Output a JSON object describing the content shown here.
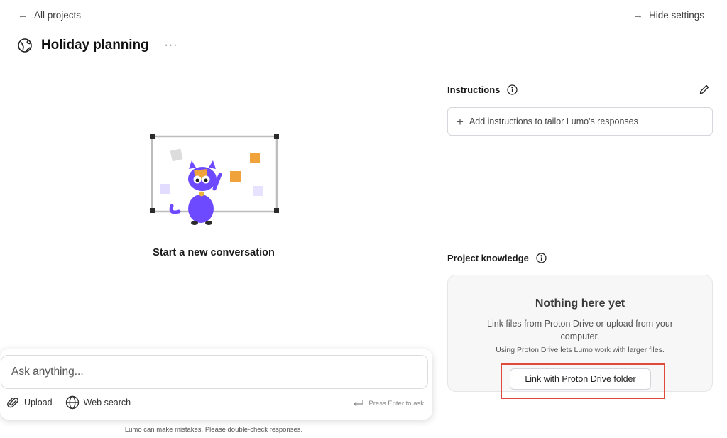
{
  "nav": {
    "back_label": "All projects",
    "hide_settings_label": "Hide settings"
  },
  "project": {
    "title": "Holiday planning",
    "more_label": "···"
  },
  "empty_chat": {
    "heading": "Start a new conversation"
  },
  "composer": {
    "placeholder": "Ask anything...",
    "upload_label": "Upload",
    "web_search_label": "Web search",
    "enter_hint": "Press Enter to ask",
    "disclaimer": "Lumo can make mistakes. Please double-check responses."
  },
  "instructions": {
    "label": "Instructions",
    "add_label": "Add instructions to tailor Lumo's responses"
  },
  "knowledge": {
    "label": "Project knowledge",
    "empty_title": "Nothing here yet",
    "empty_desc": "Link files from Proton Drive or upload from your computer.",
    "empty_hint": "Using Proton Drive lets Lumo work with larger files.",
    "link_button": "Link with Proton Drive folder"
  },
  "colors": {
    "accent_purple": "#6d4aff",
    "highlight_red": "#e04a3a",
    "note_orange": "#f0a33a"
  }
}
